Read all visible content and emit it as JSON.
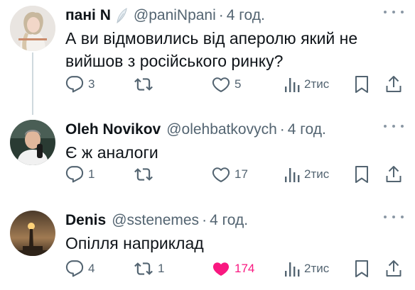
{
  "tweets": [
    {
      "name": "пані N",
      "handle": "@paniNpani",
      "time": "4 год.",
      "text_lines": [
        "А ви відмовились від аперолю який не",
        "вийшов з російського ринку?"
      ],
      "replies": "3",
      "reposts": "",
      "likes": "5",
      "views": "2тис",
      "liked": false
    },
    {
      "name": "Oleh Novikov",
      "handle": "@olehbatkovych",
      "time": "4 год.",
      "text_lines": [
        "Є ж аналоги"
      ],
      "replies": "1",
      "reposts": "",
      "likes": "17",
      "views": "2тис",
      "liked": false
    },
    {
      "name": "Denis",
      "handle": "@sstenemes",
      "time": "4 год.",
      "text_lines": [
        "Опілля наприклад"
      ],
      "replies": "4",
      "reposts": "1",
      "likes": "174",
      "views": "2тис",
      "liked": true
    }
  ],
  "separator": "·",
  "colors": {
    "text": "#0f1419",
    "secondary": "#536471",
    "like_active": "#f91880",
    "thread_line": "#cfd9de"
  },
  "icons": [
    "feather-icon",
    "reply-icon",
    "repost-icon",
    "like-icon",
    "views-icon",
    "bookmark-icon",
    "share-icon",
    "more-icon"
  ]
}
